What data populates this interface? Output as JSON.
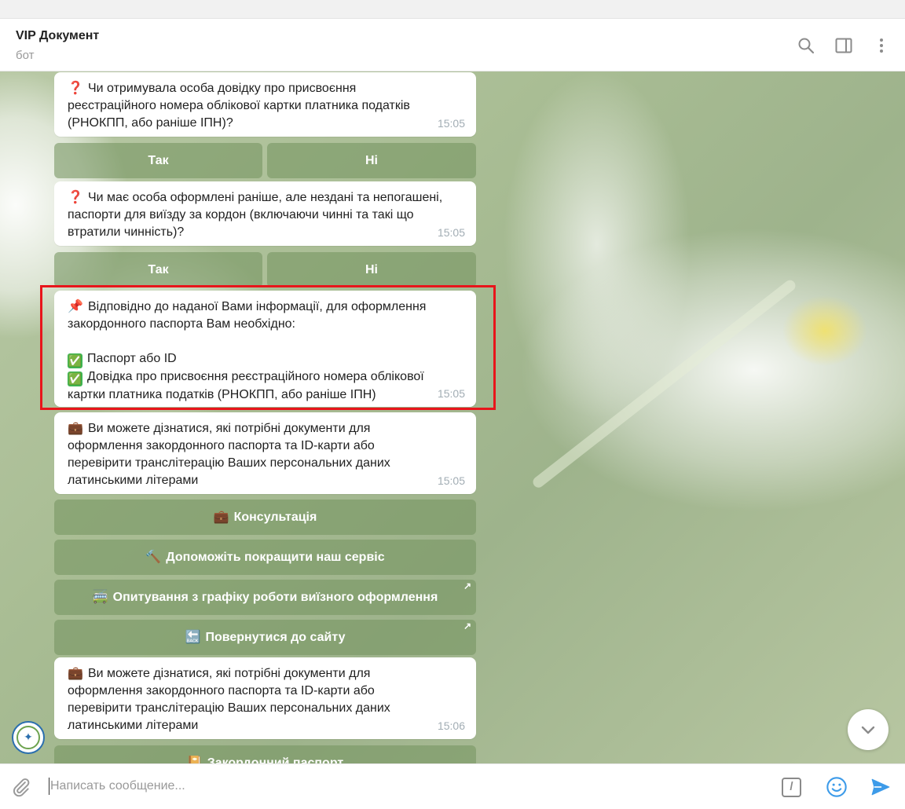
{
  "header": {
    "title": "VIP Документ",
    "subtitle": "бот",
    "icons": [
      "search-icon",
      "sidebar-toggle-icon",
      "more-vertical-icon"
    ]
  },
  "messages": [
    {
      "emoji": "❓",
      "lines": [
        "Чи отримувала особа довідку про присвоєння",
        "реєстраційного номера облікової картки платника податків",
        "(РНОКПП, або раніше ІПН)?"
      ],
      "time": "15:05",
      "buttons": [
        "Так",
        "Ні"
      ]
    },
    {
      "emoji": "❓",
      "lines": [
        "Чи має особа оформлені раніше, але нездані та непогашені,",
        "паспорти для виїзду за кордон (включаючи чинні та такі що",
        "втратили чинність)?"
      ],
      "time": "15:05",
      "buttons": [
        "Так",
        "Ні"
      ]
    },
    {
      "emoji": "📌",
      "lines": [
        "Відповідно до наданої Вами інформації, для оформлення",
        "закордонного паспорта Вам необхідно:"
      ],
      "checks": [
        "Паспорт або ID",
        "Довідка про присвоєння реєстраційного номера облікової"
      ],
      "check_tail": "картки платника податків (РНОКПП, або раніше ІПН)",
      "check_emoji": "✅",
      "time": "15:05"
    },
    {
      "emoji": "💼",
      "lines": [
        "Ви можете дізнатися, які потрібні документи для",
        "оформлення закордонного паспорта та ID-карти або",
        "перевірити транслітерацію Ваших персональних даних",
        "латинськими літерами"
      ],
      "time": "15:05",
      "menu": [
        {
          "emoji": "💼",
          "label": "Консультація",
          "external": false
        },
        {
          "emoji": "🔨",
          "label": "Допоможіть покращити наш сервіс",
          "external": false
        },
        {
          "emoji": "🚎",
          "label": "Опитування з графіку роботи виїзного оформлення",
          "external": true
        },
        {
          "emoji": "🔙",
          "label": "Повернутися до сайту",
          "external": true
        }
      ]
    },
    {
      "emoji": "💼",
      "lines": [
        "Ви можете дізнатися, які потрібні документи для",
        "оформлення закордонного паспорта та ID-карти або",
        "перевірити транслітерацію Ваших персональних даних",
        "латинськими літерами"
      ],
      "time": "15:06",
      "menu": [
        {
          "emoji": "📔",
          "label": "Закордонний паспорт",
          "external": false
        }
      ]
    }
  ],
  "external_arrow": "↗",
  "composer": {
    "placeholder": "Написать сообщение...",
    "command_symbol": "/",
    "icons": [
      "paperclip-icon",
      "command-icon",
      "emoji-icon",
      "send-icon"
    ]
  },
  "colors": {
    "highlight": "#e8151b",
    "button_bg": "rgba(118,148,96,0.58)",
    "send": "#3d9be9",
    "time": "#a2adb4"
  }
}
